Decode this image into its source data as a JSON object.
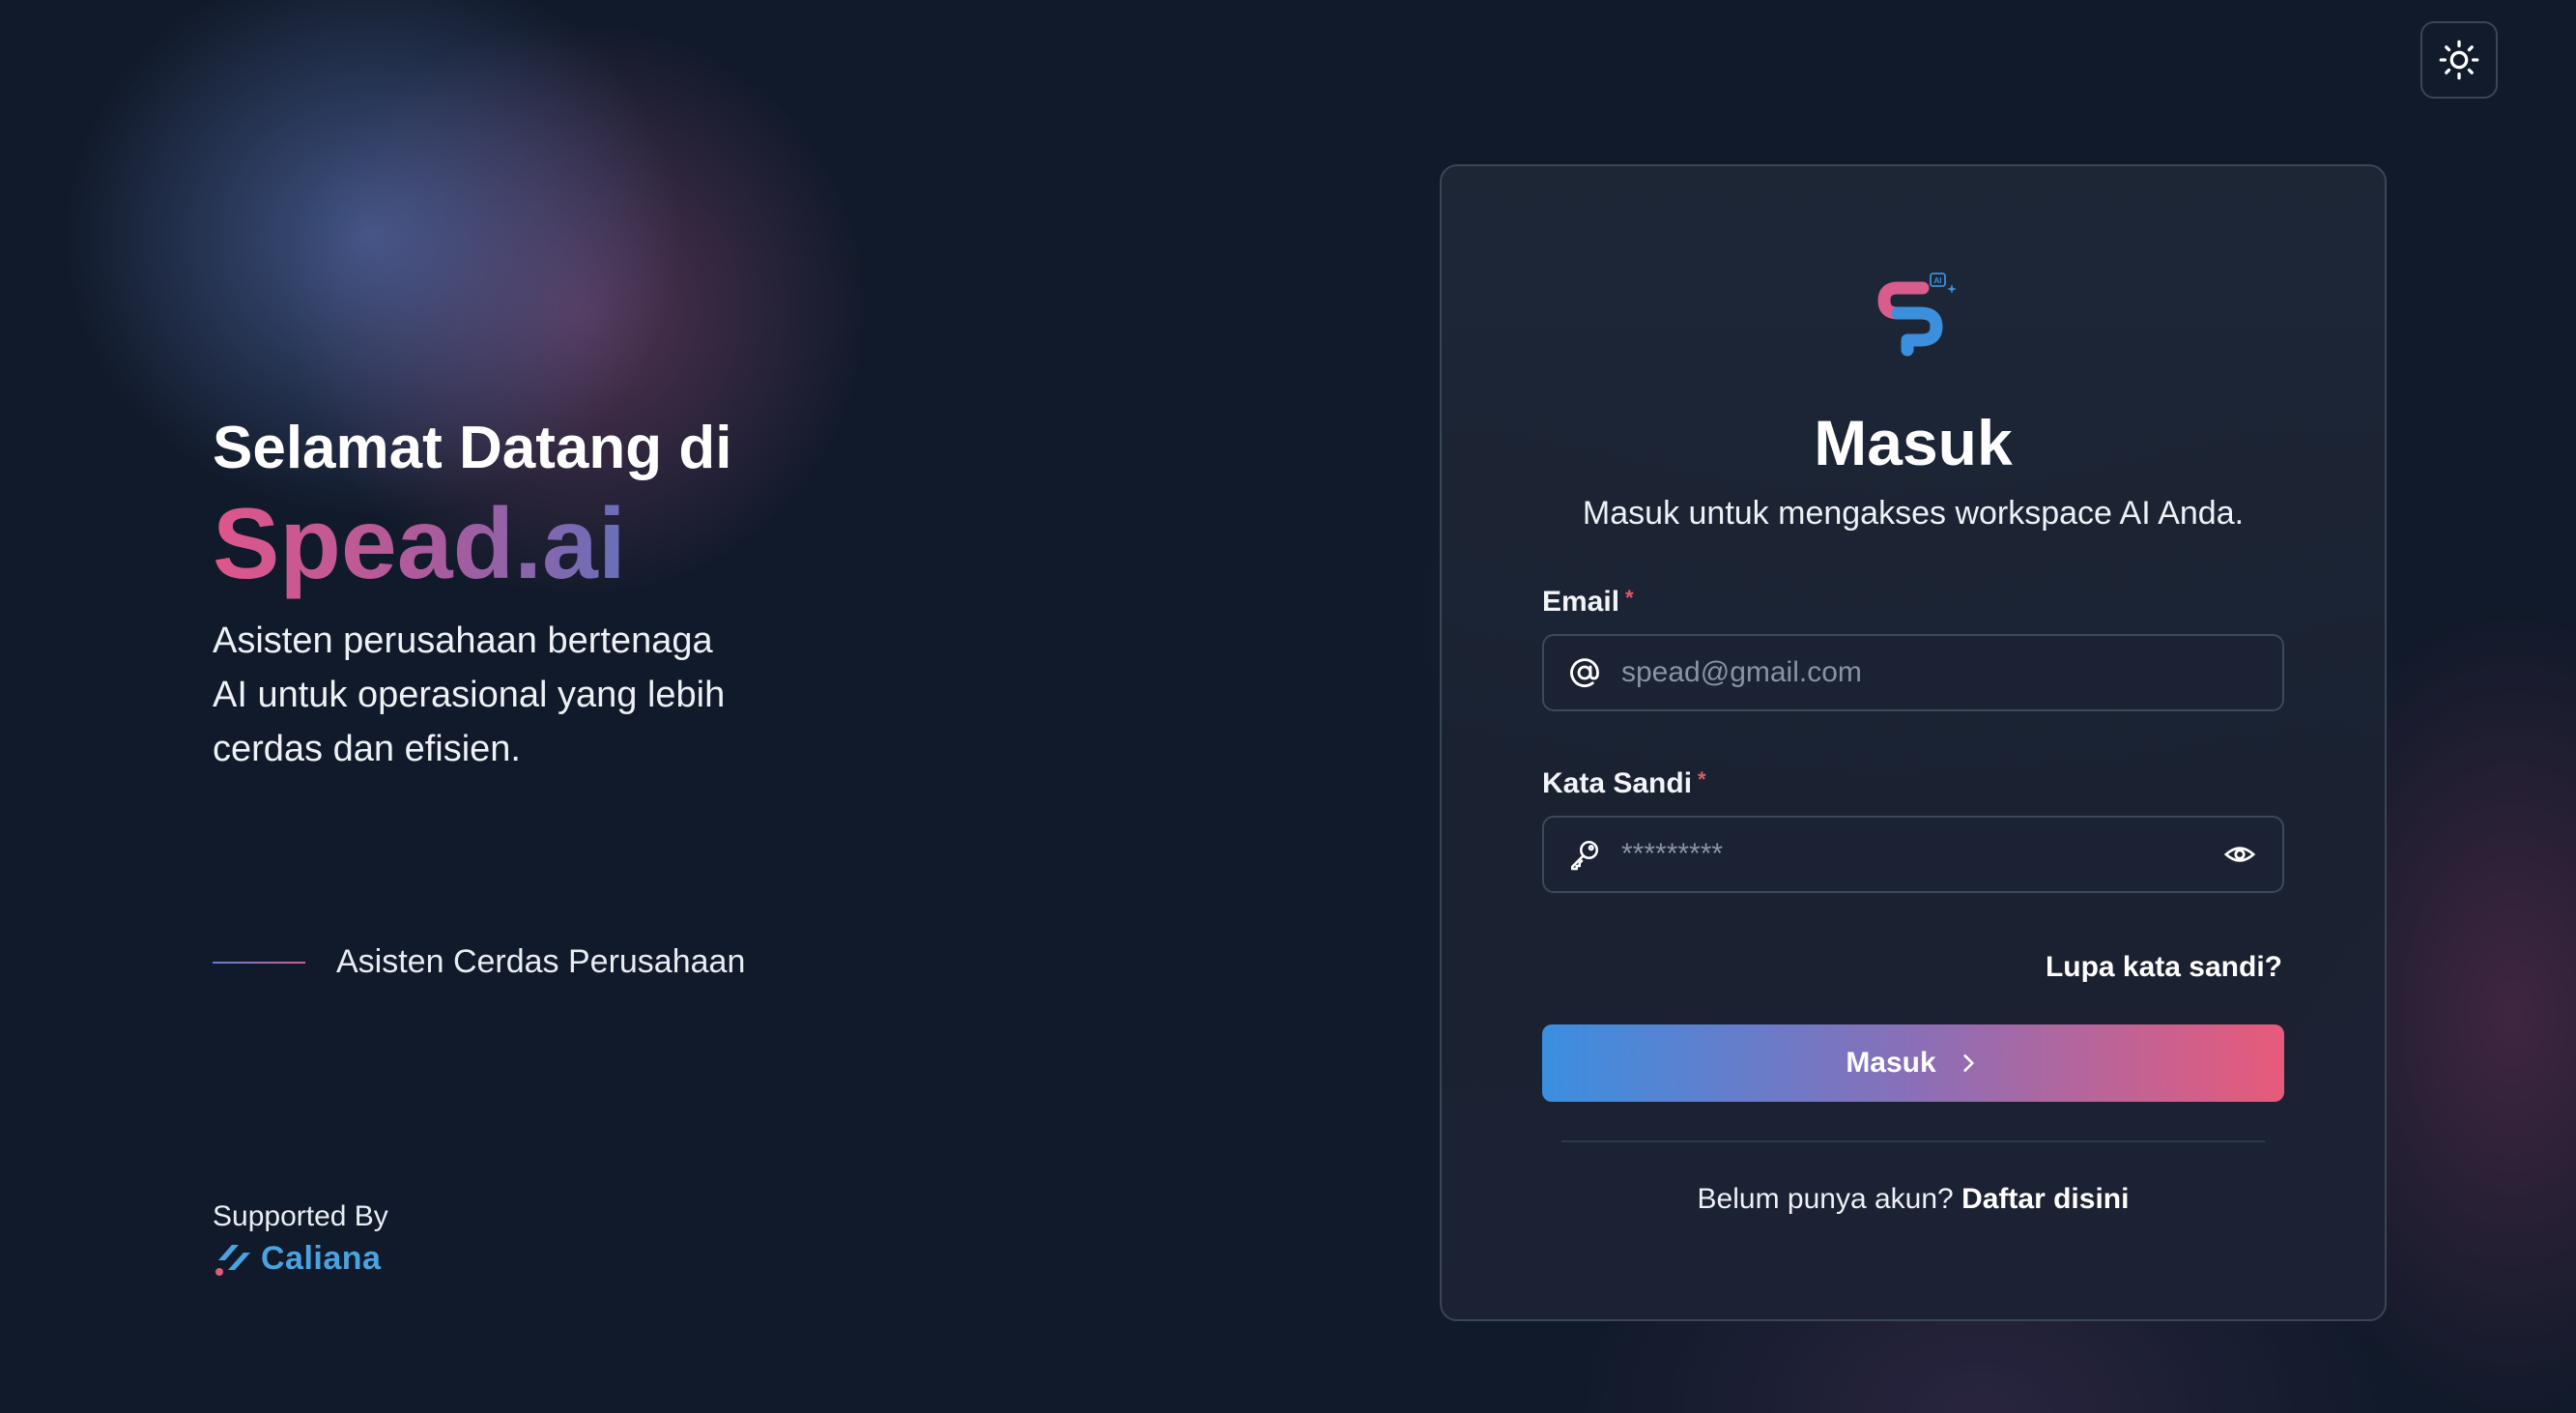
{
  "colors": {
    "background": "#111a2a",
    "card": "#1e2737",
    "brand_pink": "#e0568a",
    "brand_blue": "#3f86d8",
    "required": "#e05a6a"
  },
  "theme_toggle": {
    "icon": "sun-icon"
  },
  "hero": {
    "heading": "Selamat Datang di",
    "brand": "Spead.ai",
    "description": "Asisten perusahaan bertenaga AI untuk operasional yang lebih cerdas dan efisien.",
    "tagline": "Asisten Cerdas Perusahaan"
  },
  "supported": {
    "label": "Supported By",
    "brand": "Caliana"
  },
  "login": {
    "logo_badge": "AI",
    "title": "Masuk",
    "subtitle": "Masuk untuk mengakses workspace AI Anda.",
    "email": {
      "label": "Email",
      "required_mark": "*",
      "placeholder": "spead@gmail.com",
      "value": "",
      "icon": "at-sign-icon"
    },
    "password": {
      "label": "Kata Sandi",
      "required_mark": "*",
      "placeholder": "*********",
      "value": "",
      "icon": "key-icon",
      "toggle_icon": "eye-icon"
    },
    "forgot_label": "Lupa kata sandi?",
    "submit_label": "Masuk",
    "submit_icon": "chevron-right-icon",
    "register_prompt": "Belum punya akun?",
    "register_link": "Daftar disini"
  }
}
